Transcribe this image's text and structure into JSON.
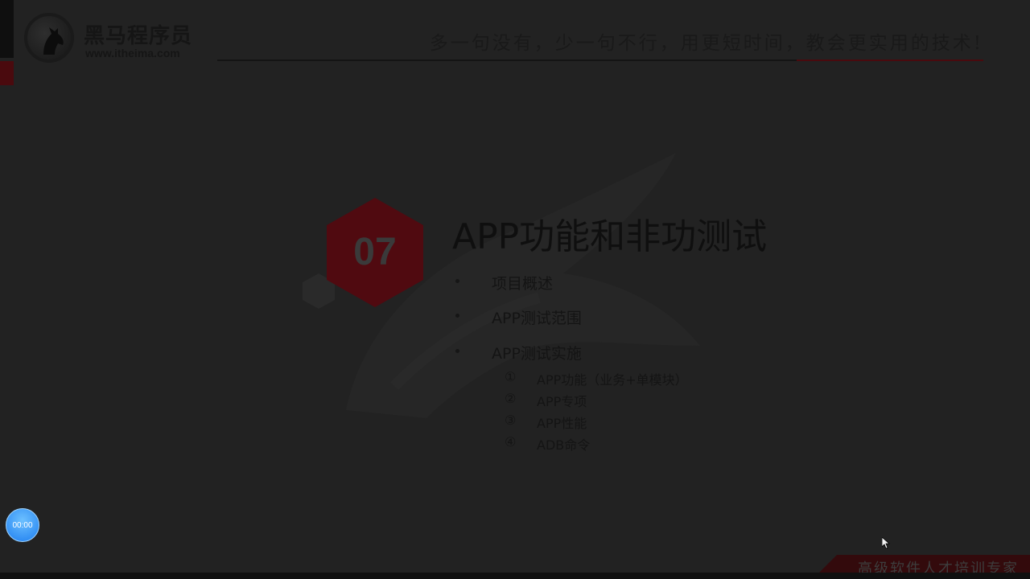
{
  "header": {
    "logo_cn": "黑马程序员",
    "logo_url": "www.itheima.com",
    "slogan": "多一句没有，少一句不行，用更短时间，教会更实用的技术!"
  },
  "section": {
    "number": "07",
    "title": "APP功能和非功测试",
    "bullets": [
      {
        "label": "项目概述"
      },
      {
        "label": "APP测试范围"
      },
      {
        "label": "APP测试实施"
      }
    ],
    "sub_items": [
      {
        "num": "①",
        "label": "APP功能（业务+单模块）"
      },
      {
        "num": "②",
        "label": "APP专项"
      },
      {
        "num": "③",
        "label": "APP性能"
      },
      {
        "num": "④",
        "label": "ADB命令"
      }
    ]
  },
  "footer": {
    "tagline": "高级软件人才培训专家"
  },
  "player": {
    "timer": "00:00"
  },
  "colors": {
    "accent_red": "#4a0a0e",
    "hex_red": "#500a10",
    "timer_blue": "#2a8cf5",
    "background": "#222222"
  },
  "icons": {
    "logo": "horse-logo-icon",
    "cursor": "mouse-cursor-icon"
  }
}
